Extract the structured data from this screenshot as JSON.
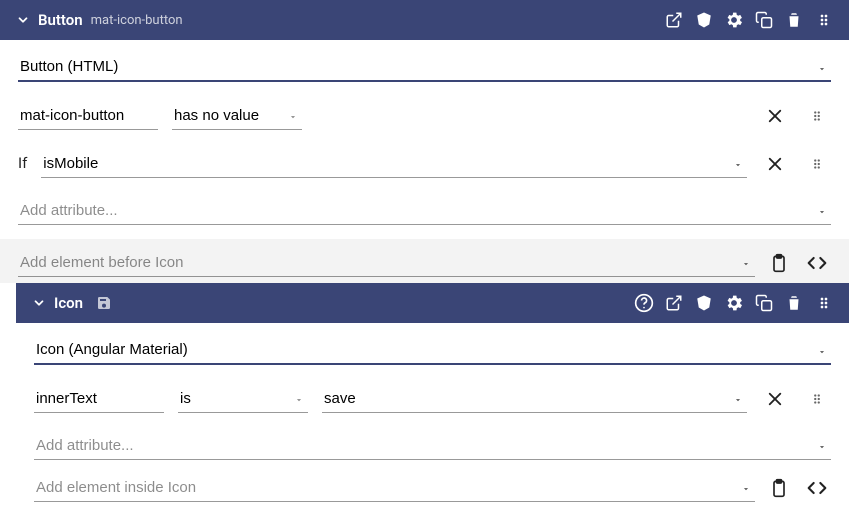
{
  "button_panel": {
    "title": "Button",
    "subtitle": "mat-icon-button",
    "type_value": "Button (HTML)",
    "attr_name": "mat-icon-button",
    "attr_op": "has no value",
    "if_label": "If",
    "if_value": "isMobile",
    "add_attr_placeholder": "Add attribute...",
    "add_before_placeholder": "Add element before Icon"
  },
  "icon_panel": {
    "title": "Icon",
    "type_value": "Icon (Angular Material)",
    "attr_name": "innerText",
    "attr_op": "is",
    "attr_value": "save",
    "add_attr_placeholder": "Add attribute...",
    "add_inside_placeholder": "Add element inside Icon"
  }
}
